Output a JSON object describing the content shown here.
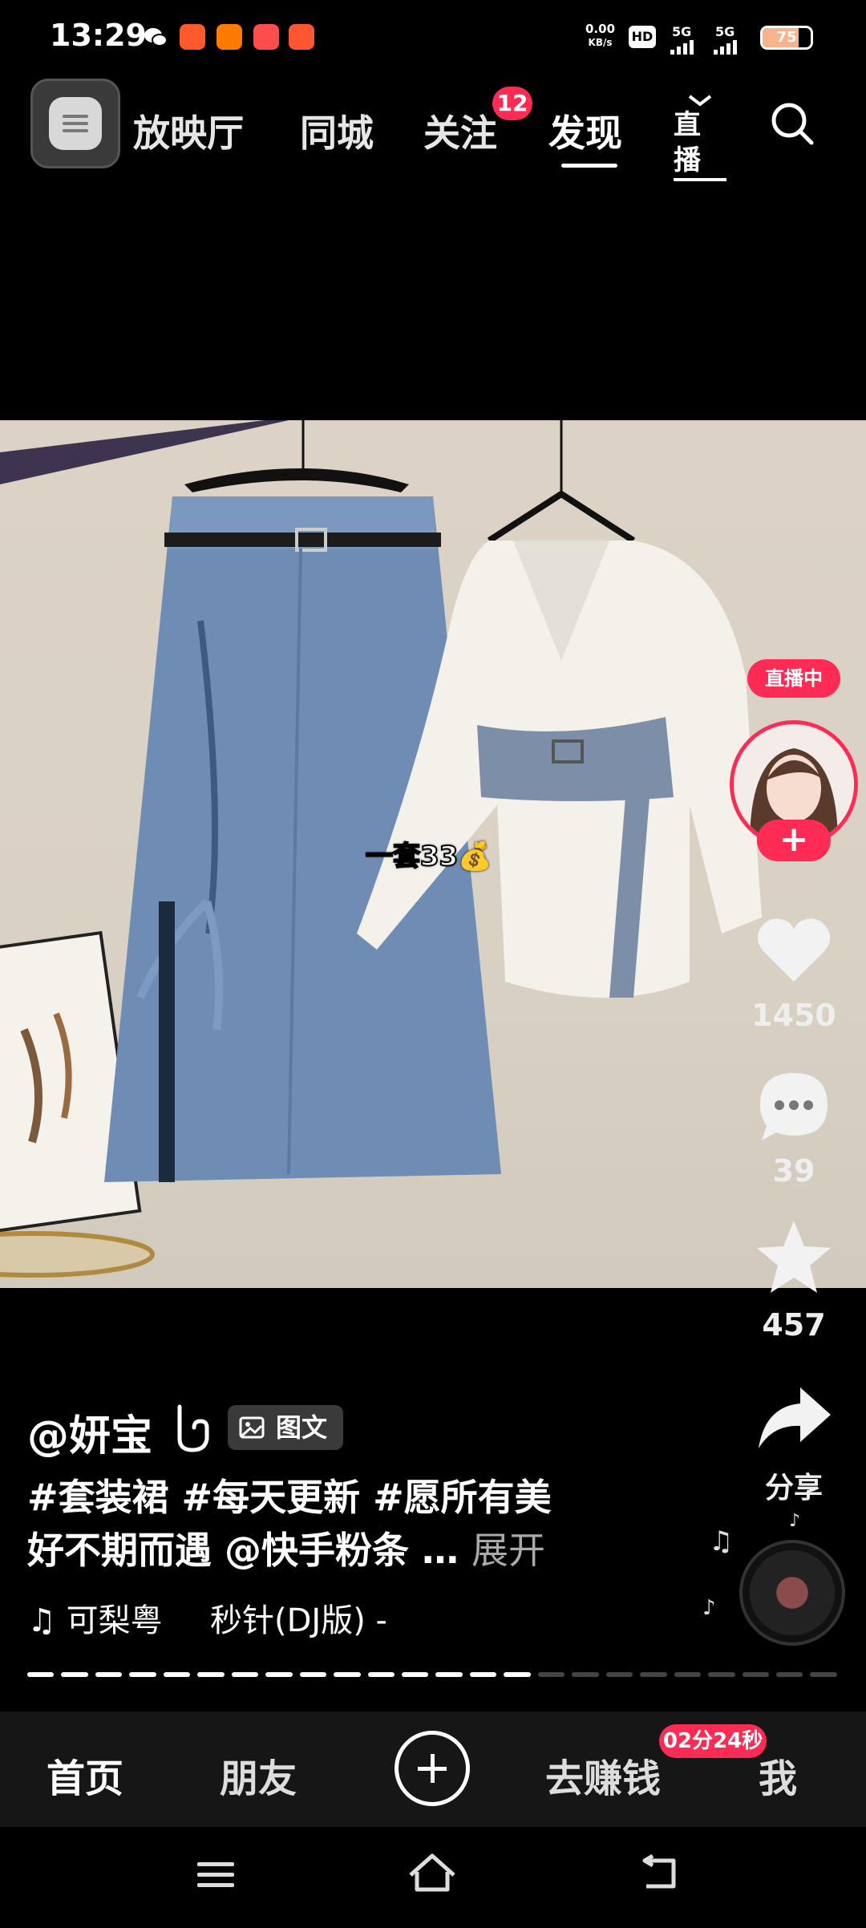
{
  "status_bar": {
    "time": "13:29",
    "net_speed_value": "0.00",
    "net_speed_unit": "KB/s",
    "hd": "HD",
    "sim1": "5G",
    "sim2": "5G",
    "battery": "75",
    "battery_level": 0.75
  },
  "top_nav": {
    "tabs": [
      "放映厅",
      "同城",
      "关注",
      "发现"
    ],
    "active_tab": "发现",
    "follow_badge": "12",
    "live_label": "直播"
  },
  "media": {
    "price_overlay": "一套33💰"
  },
  "right_rail": {
    "live_chip": "直播中",
    "follow_plus": "+",
    "likes": "1450",
    "comments": "39",
    "favorites": "457",
    "share_label": "分享"
  },
  "post": {
    "author": "@妍宝",
    "type_chip": "图文",
    "caption_line1": "#套装裙 #每天更新 #愿所有美",
    "caption_line2": "好不期而遇 @快手粉条 …",
    "expand": "展开",
    "music_artist": "♫ 可梨粤",
    "music_title": "秒针(DJ版) -"
  },
  "progress": {
    "total": 24,
    "current": 15
  },
  "bottom_nav": {
    "home": "首页",
    "friends": "朋友",
    "earn": "去赚钱",
    "me": "我",
    "timer": "02分24秒"
  },
  "colors": {
    "accent": "#fe2c55",
    "background": "#000000"
  }
}
